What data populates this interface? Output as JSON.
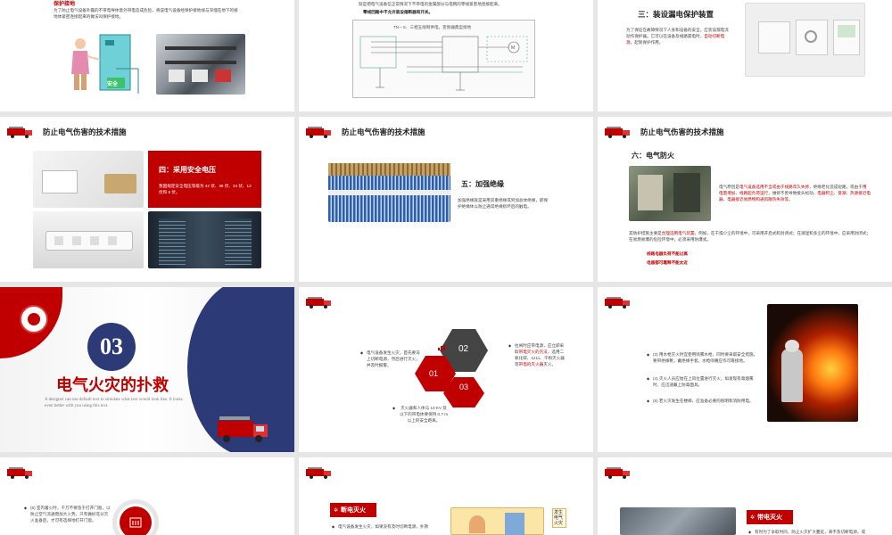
{
  "slides": {
    "s1": {
      "heading": "保护接地",
      "body": "为了防止电气设备外露的不带电导体意外带电造成危险，将该电气设备经保护接地线与深埋在地下的接地体紧密连接起来的做法叫保护接地。",
      "sign_text": "安全"
    },
    "s2": {
      "line1": "就是把电气设备在正常情况下不带电的金属部分与电网的零线紧密地连接起来。",
      "line2": "零线回路中不允许装设熔断器和开关。",
      "diagram_title": "TN－S、三相五线制供电，变频器典型接地"
    },
    "s3": {
      "heading": "三：装设漏电保护装置",
      "body": "为了保证在故障情况下人身和设备的安全，应装设漏电流动作保护器。它可以在设备及线路漏电时，",
      "body_red": "自动切断电源",
      "body_end": "，起到保护作用。"
    },
    "common_title": "防止电气伤害的技术措施",
    "s4": {
      "heading": "四：采用安全电压",
      "body": "我国规定安全电压等级为 42 伏、36 伏、24 伏、12 伏和 6 伏。"
    },
    "s5": {
      "heading": "五：加强绝缘",
      "body": "加强绝缘就是采用双重绝缘或另加总体绝缘，即保护绝缘体以防止通常绝缘损坏后的触电。"
    },
    "s6": {
      "heading": "六：电气防火",
      "p1_a": "电气原因是",
      "p1_b": "电气设备选用不当或由于线路年久失修",
      "p1_c": "，绝缘老化造成短路，或由于",
      "p1_d": "用电量增加、线路超负荷运行",
      "p1_e": "，维修不善导致接头松动，",
      "p1_f": "电器积尘、受潮、热源接近电器、电器接近易燃物和通风散热失效等",
      "p1_g": "。",
      "p2_a": "其防护措施主要是",
      "p2_b": "合理选用电气装置",
      "p2_c": "。例如，在干燥少尘的环境中，可采用开启式和封闭式；在潮湿和多尘的环境中，应采用封闭式；在易燃易爆的危险环境中，必须采用防爆式。",
      "warn1": "线路电器负荷不能过高",
      "warn2": "电器都可靠释不能太近"
    },
    "s7": {
      "number": "03",
      "title": "电气火灾的扑救",
      "subtitle": "A designer can use default text to simulate what text would look like. It looks even better with you using this text."
    },
    "fire_title": "电气火灾的扑救",
    "s8": {
      "hex1": "01",
      "hex2": "02",
      "hex3": "03",
      "left_text": "电气设备发生火灾，首先要马上切断电源，然后进行灭火，并及时报警。",
      "right_text_a": "拉闸时应带电源，应立即采取",
      "right_text_b": "带电灭火的方法",
      "right_text_c": "，选用二氧化碳、1211、干粉灭火器等",
      "right_text_d": "带电的灭火器",
      "right_text_e": "灭火。",
      "bottom_text": "灭火器和人体与 10 KV 及以下的带电体要保持 0.7 m 以上的安全距离。"
    },
    "s9": {
      "b1": "(3) 用水枪灭火时宜使用喷雾水枪，同时要采取安全措施，要带绝缘靴，戴绝缘手套，水枪喷嘴应作可靠接地。",
      "b2": "(4) 灭火人员应始在上风位置进行灭火，如发现有毒烟雾时，应迅速戴上防毒面具。",
      "b3": "(5) 若火灾发生在楼梯，应准备必要的照明和消防用电。"
    },
    "s10": {
      "b1": "(6) 室内着火时，千万不要急于打开门窗，以防止空气流通而加大火势。只有做好充分灭火准备后，才可有选择地打开门窗。"
    },
    "s11": {
      "label": "断电灭火",
      "body": "电气设备发生火灾，如果没有及时切断电源，扑救",
      "cartoon_text": "发生电气火灾"
    },
    "s12": {
      "label": "带电灭火",
      "body": "有时为了争取时间，防止火灾扩大蔓延，来不及切断电源，或"
    },
    "colors": {
      "accent": "#c00000",
      "navy": "#2d3a78"
    }
  }
}
